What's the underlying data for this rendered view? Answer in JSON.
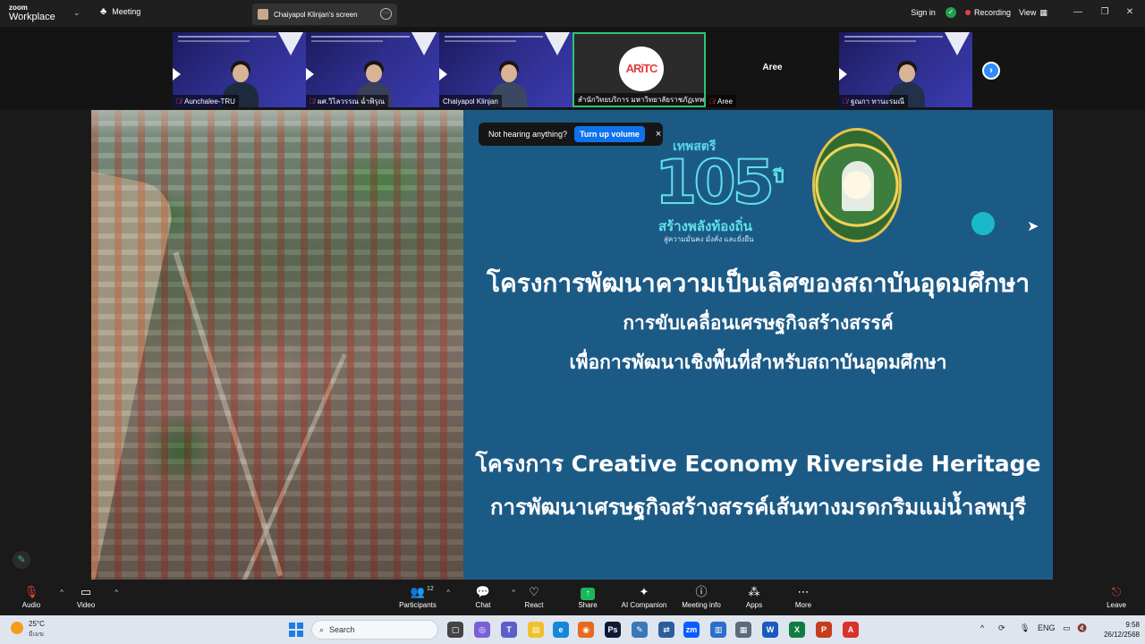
{
  "titlebar": {
    "brand_top": "zoom",
    "brand_bottom": "Workplace",
    "meeting_label": "Meeting",
    "screen_tab_label": "Chaiyapol Klinjan's screen",
    "signin_label": "Sign in",
    "recording_label": "Recording",
    "view_label": "View"
  },
  "participants": [
    {
      "name": "Aunchalee-TRU",
      "muted": true
    },
    {
      "name": "ผศ.วิไลวรรณ ฉ่ำพิรุณ",
      "muted": true
    },
    {
      "name": "Chaiyapol Klinjan",
      "muted": false
    },
    {
      "name": "สำนักวิทยบริการ มหาวิทยาลัยราชภัฏเทพ...",
      "muted": false,
      "logo_text": "ARiTC"
    },
    {
      "name": "Aree",
      "muted": true,
      "center_name": "Aree"
    },
    {
      "name": "ฐณกา ทานะรมณี",
      "muted": true
    }
  ],
  "toast": {
    "message": "Not hearing anything?",
    "action": "Turn up volume",
    "close": "×"
  },
  "slide": {
    "logo_top": "เทพสตรี",
    "logo_number": "105",
    "logo_suffix": "ปี",
    "logo_sub1": "สร้างพลังท้องถิ่น",
    "logo_sub2": "สู่ความมั่นคง มั่งคั่ง และยั่งยืน",
    "line1": "โครงการพัฒนาความเป็นเลิศของสถาบันอุดมศึกษา",
    "line2": "การขับเคลื่อนเศรษฐกิจสร้างสรรค์",
    "line3": "เพื่อการพัฒนาเชิงพื้นที่สำหรับสถาบันอุดมศึกษา",
    "line4": "โครงการ Creative Economy Riverside Heritage",
    "line5": "การพัฒนาเศรษฐกิจสร้างสรรค์เส้นทางมรดกริมแม่น้ำลพบุรี"
  },
  "toolbar": {
    "audio": "Audio",
    "video": "Video",
    "participants": "Participants",
    "participants_count": "12",
    "chat": "Chat",
    "react": "React",
    "share": "Share",
    "ai_companion": "AI Companion",
    "meeting_info": "Meeting info",
    "apps": "Apps",
    "more": "More",
    "leave": "Leave"
  },
  "taskbar": {
    "weather_temp": "25°C",
    "weather_desc": "มีเมฆ",
    "search_placeholder": "Search",
    "lang": "ENG",
    "time": "9:58",
    "date": "26/12/2568"
  },
  "colors": {
    "zoom_blue": "#0e72ed",
    "recording_red": "#e8413d",
    "active_speaker_green": "#2fc46f",
    "slide_bg": "#1c5a86",
    "logo_cyan": "#5fe1e8"
  }
}
